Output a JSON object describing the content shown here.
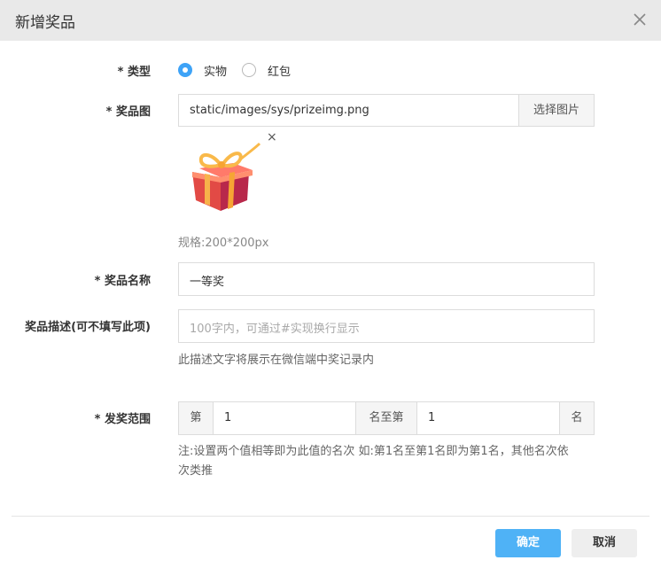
{
  "dialog": {
    "title": "新增奖品",
    "close_icon": "close-icon"
  },
  "type_field": {
    "label": "* 类型",
    "options": [
      "实物",
      "红包"
    ],
    "selected": "实物"
  },
  "image_field": {
    "label": "* 奖品图",
    "value": "static/images/sys/prizeimg.png",
    "choose_button": "选择图片",
    "remove_icon": "×",
    "preview_icon": "gift-box-icon",
    "spec": "规格:200*200px"
  },
  "name_field": {
    "label": "* 奖品名称",
    "value": "一等奖"
  },
  "desc_field": {
    "label": "奖品描述(可不填写此项)",
    "placeholder": "100字内，可通过#实现换行显示",
    "help": "此描述文字将展示在微信端中奖记录内"
  },
  "range_field": {
    "label": "* 发奖范围",
    "prefix": "第",
    "from_value": "1",
    "middle": "名至第",
    "to_value": "1",
    "suffix": "名",
    "note_line1": "注:设置两个值相等即为此值的名次 如:第1名至第1名即为第1名，其他名次依",
    "note_line2": "次类推"
  },
  "footer": {
    "confirm": "确定",
    "cancel": "取消"
  },
  "colors": {
    "primary": "#4fb2f6",
    "header_bg": "#e9e9e9",
    "radio_active": "#3ea3f7"
  }
}
